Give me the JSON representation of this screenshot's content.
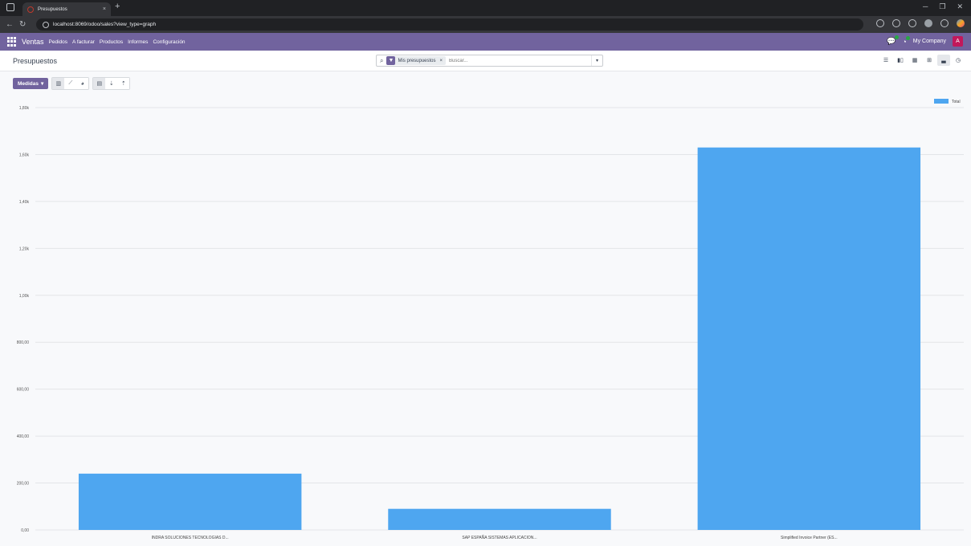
{
  "browser": {
    "tab_title": "Presupuestos",
    "tab_close": "×",
    "new_tab": "+",
    "url": "localhost:8069/odoo/sales?view_type=graph"
  },
  "navbar": {
    "app_name": "Ventas",
    "menu": [
      "Pedidos",
      "A facturar",
      "Productos",
      "Informes",
      "Configuración"
    ],
    "company": "My Company",
    "user_initial": "A"
  },
  "control_panel": {
    "breadcrumb": "Presupuestos",
    "search": {
      "facet_label": "Mis presupuestos",
      "facet_remove": "×",
      "placeholder": "Buscar..."
    }
  },
  "graph_toolbar": {
    "measures_label": "Medidas"
  },
  "colors": {
    "primary": "#71639e",
    "bar": "#4ea6f0",
    "avatar": "#c2185b"
  },
  "chart_data": {
    "type": "bar",
    "categories": [
      "INDRA SOLUCIONES TECNOLOGIAS D...",
      "SAP ESPAÑA SISTEMAS APLICACION...",
      "Simplified Invoice Partner (ES..."
    ],
    "series": [
      {
        "name": "Total",
        "values": [
          240,
          90,
          1630
        ]
      }
    ],
    "y_ticks": [
      "0,00",
      "200,00",
      "400,00",
      "600,00",
      "800,00",
      "1,00k",
      "1,20k",
      "1,40k",
      "1,60k",
      "1,80k"
    ],
    "ylim": [
      0,
      1800
    ],
    "grid": true,
    "legend": "top-right"
  }
}
